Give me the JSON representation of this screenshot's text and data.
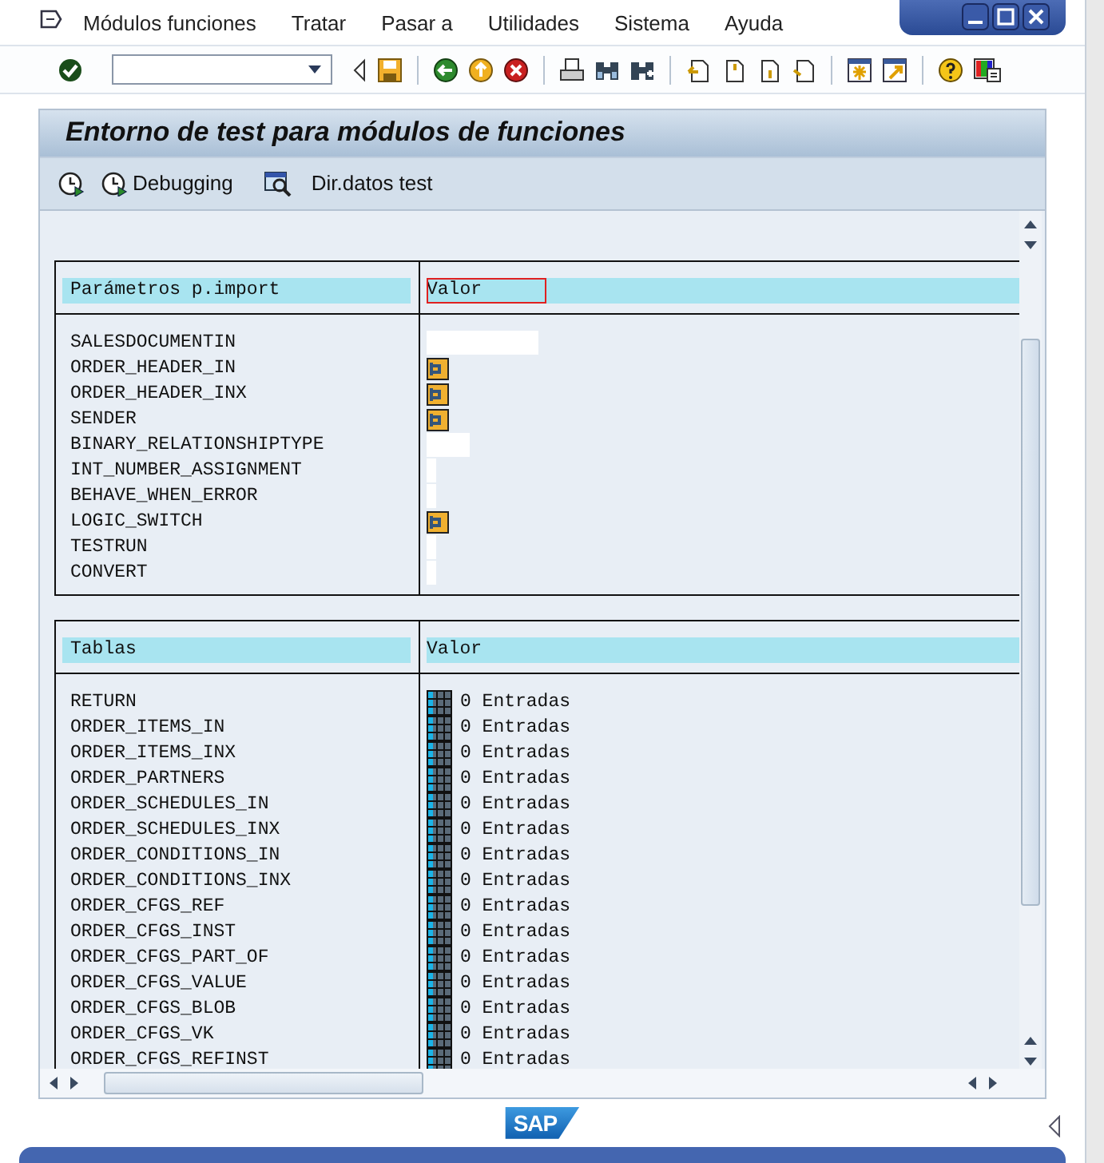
{
  "menu": [
    {
      "label": "Módulos funciones"
    },
    {
      "label": "Tratar"
    },
    {
      "label": "Pasar a"
    },
    {
      "label": "Utilidades"
    },
    {
      "label": "Sistema"
    },
    {
      "label": "Ayuda"
    }
  ],
  "title": "Entorno de test para módulos de funciones",
  "app_toolbar": [
    {
      "kind": "execute"
    },
    {
      "kind": "debug",
      "label": "Debugging"
    },
    {
      "kind": "testdata",
      "label": "Dir.datos test"
    }
  ],
  "sections": [
    {
      "header": "Parámetros p.import",
      "value_header": "Valor",
      "value_header_focused": true,
      "rows": [
        {
          "name": "SALESDOCUMENTIN",
          "kind": "long-field"
        },
        {
          "name": "ORDER_HEADER_IN",
          "kind": "structure"
        },
        {
          "name": "ORDER_HEADER_INX",
          "kind": "structure"
        },
        {
          "name": "SENDER",
          "kind": "structure"
        },
        {
          "name": "BINARY_RELATIONSHIPTYPE",
          "kind": "short-field"
        },
        {
          "name": "INT_NUMBER_ASSIGNMENT",
          "kind": "flag-field"
        },
        {
          "name": "BEHAVE_WHEN_ERROR",
          "kind": "flag-field"
        },
        {
          "name": "LOGIC_SWITCH",
          "kind": "structure"
        },
        {
          "name": "TESTRUN",
          "kind": "flag-field"
        },
        {
          "name": "CONVERT",
          "kind": "flag-field"
        }
      ]
    },
    {
      "header": "Tablas",
      "value_header": "Valor",
      "value_header_focused": false,
      "rows": [
        {
          "name": "RETURN",
          "kind": "table",
          "value": "0 Entradas"
        },
        {
          "name": "ORDER_ITEMS_IN",
          "kind": "table",
          "value": "0 Entradas"
        },
        {
          "name": "ORDER_ITEMS_INX",
          "kind": "table",
          "value": "0 Entradas"
        },
        {
          "name": "ORDER_PARTNERS",
          "kind": "table",
          "value": "0 Entradas"
        },
        {
          "name": "ORDER_SCHEDULES_IN",
          "kind": "table",
          "value": "0 Entradas"
        },
        {
          "name": "ORDER_SCHEDULES_INX",
          "kind": "table",
          "value": "0 Entradas"
        },
        {
          "name": "ORDER_CONDITIONS_IN",
          "kind": "table",
          "value": "0 Entradas"
        },
        {
          "name": "ORDER_CONDITIONS_INX",
          "kind": "table",
          "value": "0 Entradas"
        },
        {
          "name": "ORDER_CFGS_REF",
          "kind": "table",
          "value": "0 Entradas"
        },
        {
          "name": "ORDER_CFGS_INST",
          "kind": "table",
          "value": "0 Entradas"
        },
        {
          "name": "ORDER_CFGS_PART_OF",
          "kind": "table",
          "value": "0 Entradas"
        },
        {
          "name": "ORDER_CFGS_VALUE",
          "kind": "table",
          "value": "0 Entradas"
        },
        {
          "name": "ORDER_CFGS_BLOB",
          "kind": "table",
          "value": "0 Entradas"
        },
        {
          "name": "ORDER_CFGS_VK",
          "kind": "table",
          "value": "0 Entradas"
        },
        {
          "name": "ORDER_CFGS_REFINST",
          "kind": "table",
          "value": "0 Entradas"
        }
      ]
    }
  ],
  "logo": "SAP"
}
